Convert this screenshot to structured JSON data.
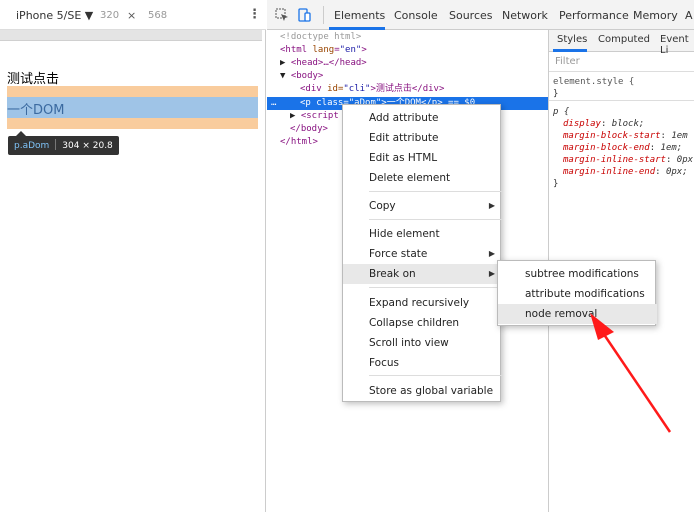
{
  "device_toolbar": {
    "device": "iPhone 5/SE ▼",
    "width": "320",
    "times": "×",
    "height": "568",
    "more": "⋮"
  },
  "page": {
    "clickable_text": "测试点击",
    "highlighted_text": "一个DOM",
    "tooltip_selector": "p.aDom",
    "tooltip_size": "304 × 20.8"
  },
  "devtools_tabs": {
    "inspect_icon": "cursor-select-icon",
    "device_icon": "device-toggle-icon",
    "tabs": [
      "Elements",
      "Console",
      "Sources",
      "Network",
      "Performance",
      "Memory",
      "A"
    ],
    "active": "Elements"
  },
  "dom_tree": {
    "doctype": "<!doctype html>",
    "html_open_tag": "<html",
    "html_attr": "lang",
    "html_val": "\"en\"",
    "head": "<head>…</head>",
    "body_open": "<body>",
    "div_tag": "<div",
    "div_attr": "id=",
    "div_val": "\"cli\"",
    "div_text": ">测试点击</div>",
    "p_line": "<p class=\"aDom\">一个DOM</p> == $0",
    "script": "<script",
    "body_close": "</body>",
    "html_close": "</html>",
    "ellipsis": "…",
    "triangle_closed": "▶",
    "triangle_open": "▼"
  },
  "styles_panel": {
    "tabs": [
      "Styles",
      "Computed",
      "Event Li"
    ],
    "filter_placeholder": "Filter",
    "element_style": "element.style {",
    "close_brace": "}",
    "p_selector": "p {",
    "props": [
      {
        "name": "display",
        "value": "block;"
      },
      {
        "name": "margin-block-start",
        "value": "1em"
      },
      {
        "name": "margin-block-end",
        "value": "1em;"
      },
      {
        "name": "margin-inline-start",
        "value": "0px"
      },
      {
        "name": "margin-inline-end",
        "value": "0px;"
      }
    ]
  },
  "context_menu": {
    "items": [
      "Add attribute",
      "Edit attribute",
      "Edit as HTML",
      "Delete element",
      "Copy",
      "Hide element",
      "Force state",
      "Break on",
      "Expand recursively",
      "Collapse children",
      "Scroll into view",
      "Focus",
      "Store as global variable"
    ],
    "submenu_arrow": "▶"
  },
  "break_on_submenu": {
    "items": [
      "subtree modifications",
      "attribute modifications",
      "node removal"
    ]
  },
  "colors": {
    "selection": "#1a73e8",
    "annotation_arrow": "#ff1a1a",
    "margin_highlight": "#f9cc9d",
    "content_highlight": "#9fc4e7"
  }
}
